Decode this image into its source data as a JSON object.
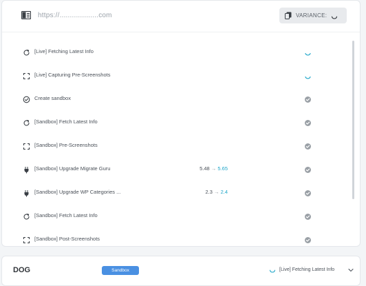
{
  "topbar": {
    "url": "https://...................com",
    "variance_label": "VARIANCE:"
  },
  "steps": [
    {
      "icon": "refresh-icon",
      "label": "[Live] Fetching Latest Info",
      "status": "loading"
    },
    {
      "icon": "capture-icon",
      "label": "[Live] Capturing Pre-Screenshots",
      "status": "loading"
    },
    {
      "icon": "check-circle-icon",
      "label": "Create sandbox",
      "status": "done"
    },
    {
      "icon": "refresh-icon",
      "label": "[Sandbox] Fetch Latest Info",
      "status": "done"
    },
    {
      "icon": "capture-icon",
      "label": "[Sandbox] Pre-Screenshots",
      "status": "done"
    },
    {
      "icon": "plug-icon",
      "label": "[Sandbox] Upgrade Migrate Guru",
      "from": "5.48",
      "to": "5.65",
      "status": "done"
    },
    {
      "icon": "plug-icon",
      "label": "[Sandbox] Upgrade WP Categories ...",
      "from": "2.3",
      "to": "2.4",
      "status": "done"
    },
    {
      "icon": "refresh-icon",
      "label": "[Sandbox] Fetch Latest Info",
      "status": "done"
    },
    {
      "icon": "capture-icon",
      "label": "[Sandbox] Post-Screenshots",
      "status": "done"
    }
  ],
  "bottom": {
    "title": "DOG",
    "badge": "Sandbox",
    "status_text": "[Live] Fetching Latest Info"
  },
  "colors": {
    "accent": "#1fa6c9",
    "badge_bg": "#4a90e2",
    "done": "#9aa0a6"
  }
}
